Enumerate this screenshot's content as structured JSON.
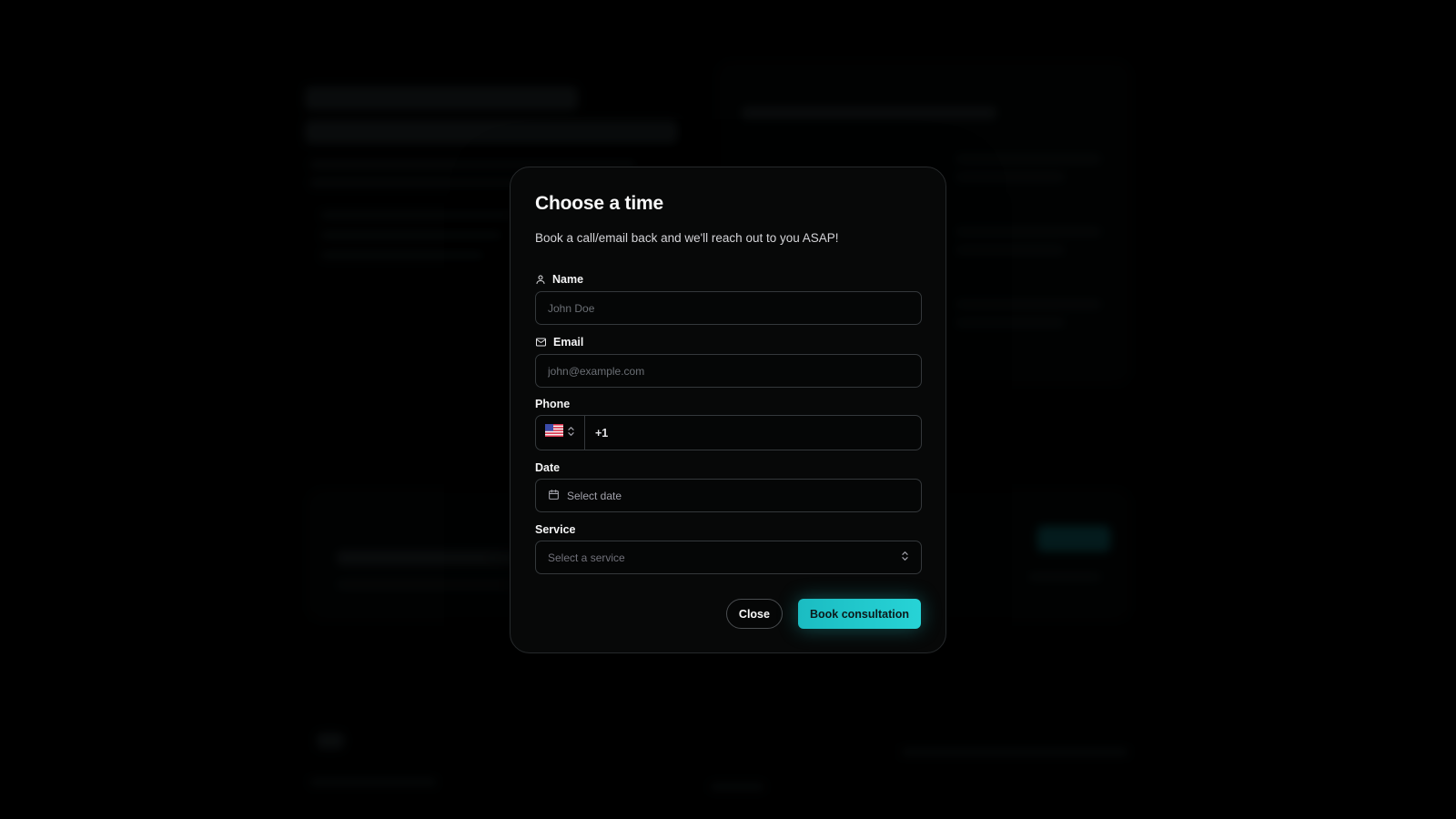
{
  "modal": {
    "title": "Choose a time",
    "description": "Book a call/email back and we'll reach out to you ASAP!"
  },
  "form": {
    "name": {
      "label": "Name",
      "placeholder": "John Doe",
      "icon": "user-icon"
    },
    "email": {
      "label": "Email",
      "placeholder": "john@example.com",
      "icon": "mail-icon"
    },
    "phone": {
      "label": "Phone",
      "country_flag": "us-flag-icon",
      "dial_code": "+1"
    },
    "date": {
      "label": "Date",
      "placeholder": "Select date",
      "icon": "calendar-icon"
    },
    "service": {
      "label": "Service",
      "placeholder": "Select a service"
    }
  },
  "actions": {
    "close_label": "Close",
    "book_label": "Book consultation"
  },
  "colors": {
    "accent": "#22d3d6",
    "background": "#000000",
    "modal_bg": "#070808"
  }
}
